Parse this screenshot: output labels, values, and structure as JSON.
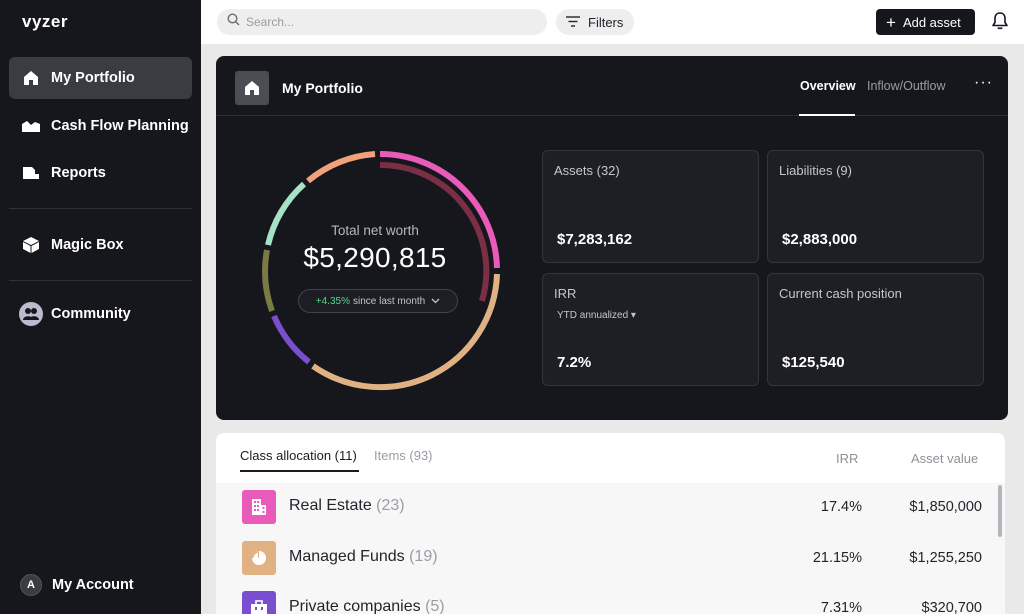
{
  "app": {
    "logo": "vyzer"
  },
  "sidebar": {
    "items": [
      {
        "label": "My Portfolio",
        "icon": "home-icon",
        "active": true
      },
      {
        "label": "Cash Flow Planning",
        "icon": "area-chart-icon"
      },
      {
        "label": "Reports",
        "icon": "report-icon"
      },
      {
        "label": "Magic Box",
        "icon": "box-icon"
      },
      {
        "label": "Community",
        "icon": "community-icon"
      }
    ],
    "account": {
      "label": "My Account",
      "initial": "A"
    }
  },
  "topbar": {
    "search_placeholder": "Search...",
    "filters_label": "Filters",
    "add_asset_label": "Add asset"
  },
  "portfolio": {
    "title": "My Portfolio",
    "tabs": [
      "Overview",
      "Inflow/Outflow"
    ],
    "more": "···",
    "net_worth_label": "Total net worth",
    "net_worth_value": "$5,290,815",
    "change_pos": "+4.35%",
    "change_text": "since last month",
    "stats": {
      "assets": {
        "label": "Assets (32)",
        "value": "$7,283,162"
      },
      "liabilities": {
        "label": "Liabilities (9)",
        "value": "$2,883,000"
      },
      "irr": {
        "label": "IRR",
        "sub": "YTD annualized ▾",
        "value": "7.2%"
      },
      "cash": {
        "label": "Current cash position",
        "value": "$125,540"
      }
    },
    "donut_colors": [
      "#e85bb8",
      "#e0b283",
      "#7a4fcf",
      "#7a7a45",
      "#a6e2c8",
      "#f0a27a",
      "#7a2f45"
    ]
  },
  "allocation": {
    "tabs": [
      "Class allocation (11)",
      "Items (93)"
    ],
    "headers": {
      "irr": "IRR",
      "value": "Asset value"
    },
    "rows": [
      {
        "name": "Real Estate",
        "count": "(23)",
        "irr": "17.4%",
        "value": "$1,850,000",
        "color": "#e85bb8"
      },
      {
        "name": "Managed Funds",
        "count": "(19)",
        "irr": "21.15%",
        "value": "$1,255,250",
        "color": "#e0b283"
      },
      {
        "name": "Private companies",
        "count": "(5)",
        "irr": "7.31%",
        "value": "$320,700",
        "color": "#7a4fcf"
      }
    ]
  }
}
